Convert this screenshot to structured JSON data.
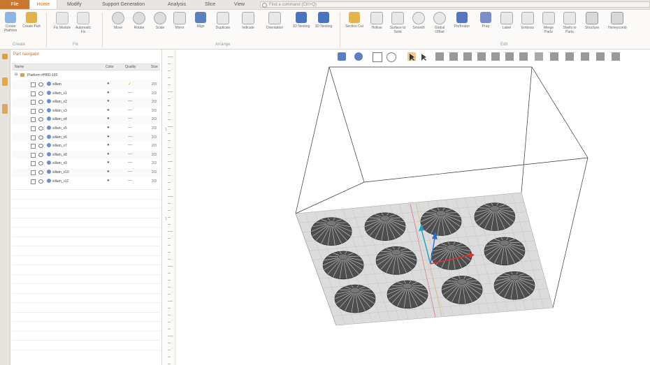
{
  "menu": {
    "file": "File",
    "home": "Home",
    "modify": "Modify",
    "support": "Support Generation",
    "analysis": "Analysis",
    "slice": "Slice",
    "view": "View",
    "search_placeholder": "Find a command (Ctrl+Q)"
  },
  "ribbon": {
    "create_platform": "Create Platform",
    "create_part": "Create Part",
    "fix_module": "Fix Module",
    "automatic_fix": "Automatic Fix",
    "move": "Move",
    "rotate": "Rotate",
    "scale": "Scale",
    "mirror": "Mirror",
    "align": "Align",
    "duplicate": "Duplicate",
    "indicate": "Indicate",
    "orientation": "Orientation",
    "nesting_2d": "2D Nesting",
    "nesting_3d": "3D Nesting",
    "section_cut": "Section Cut",
    "hollow": "Hollow",
    "surface_to_solid": "Surface to Solid",
    "smooth": "Smooth",
    "global_offset": "Global Offset",
    "perforator": "Perforator",
    "prep": "Prep",
    "label": "Label",
    "emboss": "Emboss",
    "merge_parts": "Merge Parts",
    "shells_to_parts": "Shells to Parts",
    "structure": "Structure",
    "honeycomb": "Honeycomb",
    "group_create": "Create",
    "group_fix": "Fix",
    "group_arrange": "Arrange",
    "group_edit": "Edit"
  },
  "panel": {
    "title": "Part navigator",
    "col_name": "Name",
    "col_color": "Color",
    "col_quality": "Quality",
    "col_size": "Size",
    "root": "Platform #HBD-150",
    "parts": [
      {
        "name": "sillam",
        "quality": "✓",
        "size": "2/3"
      },
      {
        "name": "sillam_x1",
        "quality": "—",
        "size": "2/3"
      },
      {
        "name": "sillam_x2",
        "quality": "—",
        "size": "2/3"
      },
      {
        "name": "sillam_x3",
        "quality": "—",
        "size": "2/3"
      },
      {
        "name": "sillam_x4",
        "quality": "—",
        "size": "2/3"
      },
      {
        "name": "sillam_x5",
        "quality": "—",
        "size": "2/3"
      },
      {
        "name": "sillam_x6",
        "quality": "—",
        "size": "2/3"
      },
      {
        "name": "sillam_x7",
        "quality": "—",
        "size": "2/3"
      },
      {
        "name": "sillam_x8",
        "quality": "—",
        "size": "2/3"
      },
      {
        "name": "sillam_x9",
        "quality": "—",
        "size": "2/3"
      },
      {
        "name": "sillam_x10",
        "quality": "—",
        "size": "2/3"
      },
      {
        "name": "sillam_x11",
        "quality": "—",
        "size": "2/3"
      }
    ]
  },
  "ruler": {
    "labels": [
      "1",
      "1"
    ]
  },
  "colors": {
    "accent": "#d07020",
    "file_bg": "#c8782e",
    "check": "#e0a020",
    "axis_x": "#e03030",
    "axis_y": "#20a0c0",
    "axis_z": "#2a6fd0"
  }
}
